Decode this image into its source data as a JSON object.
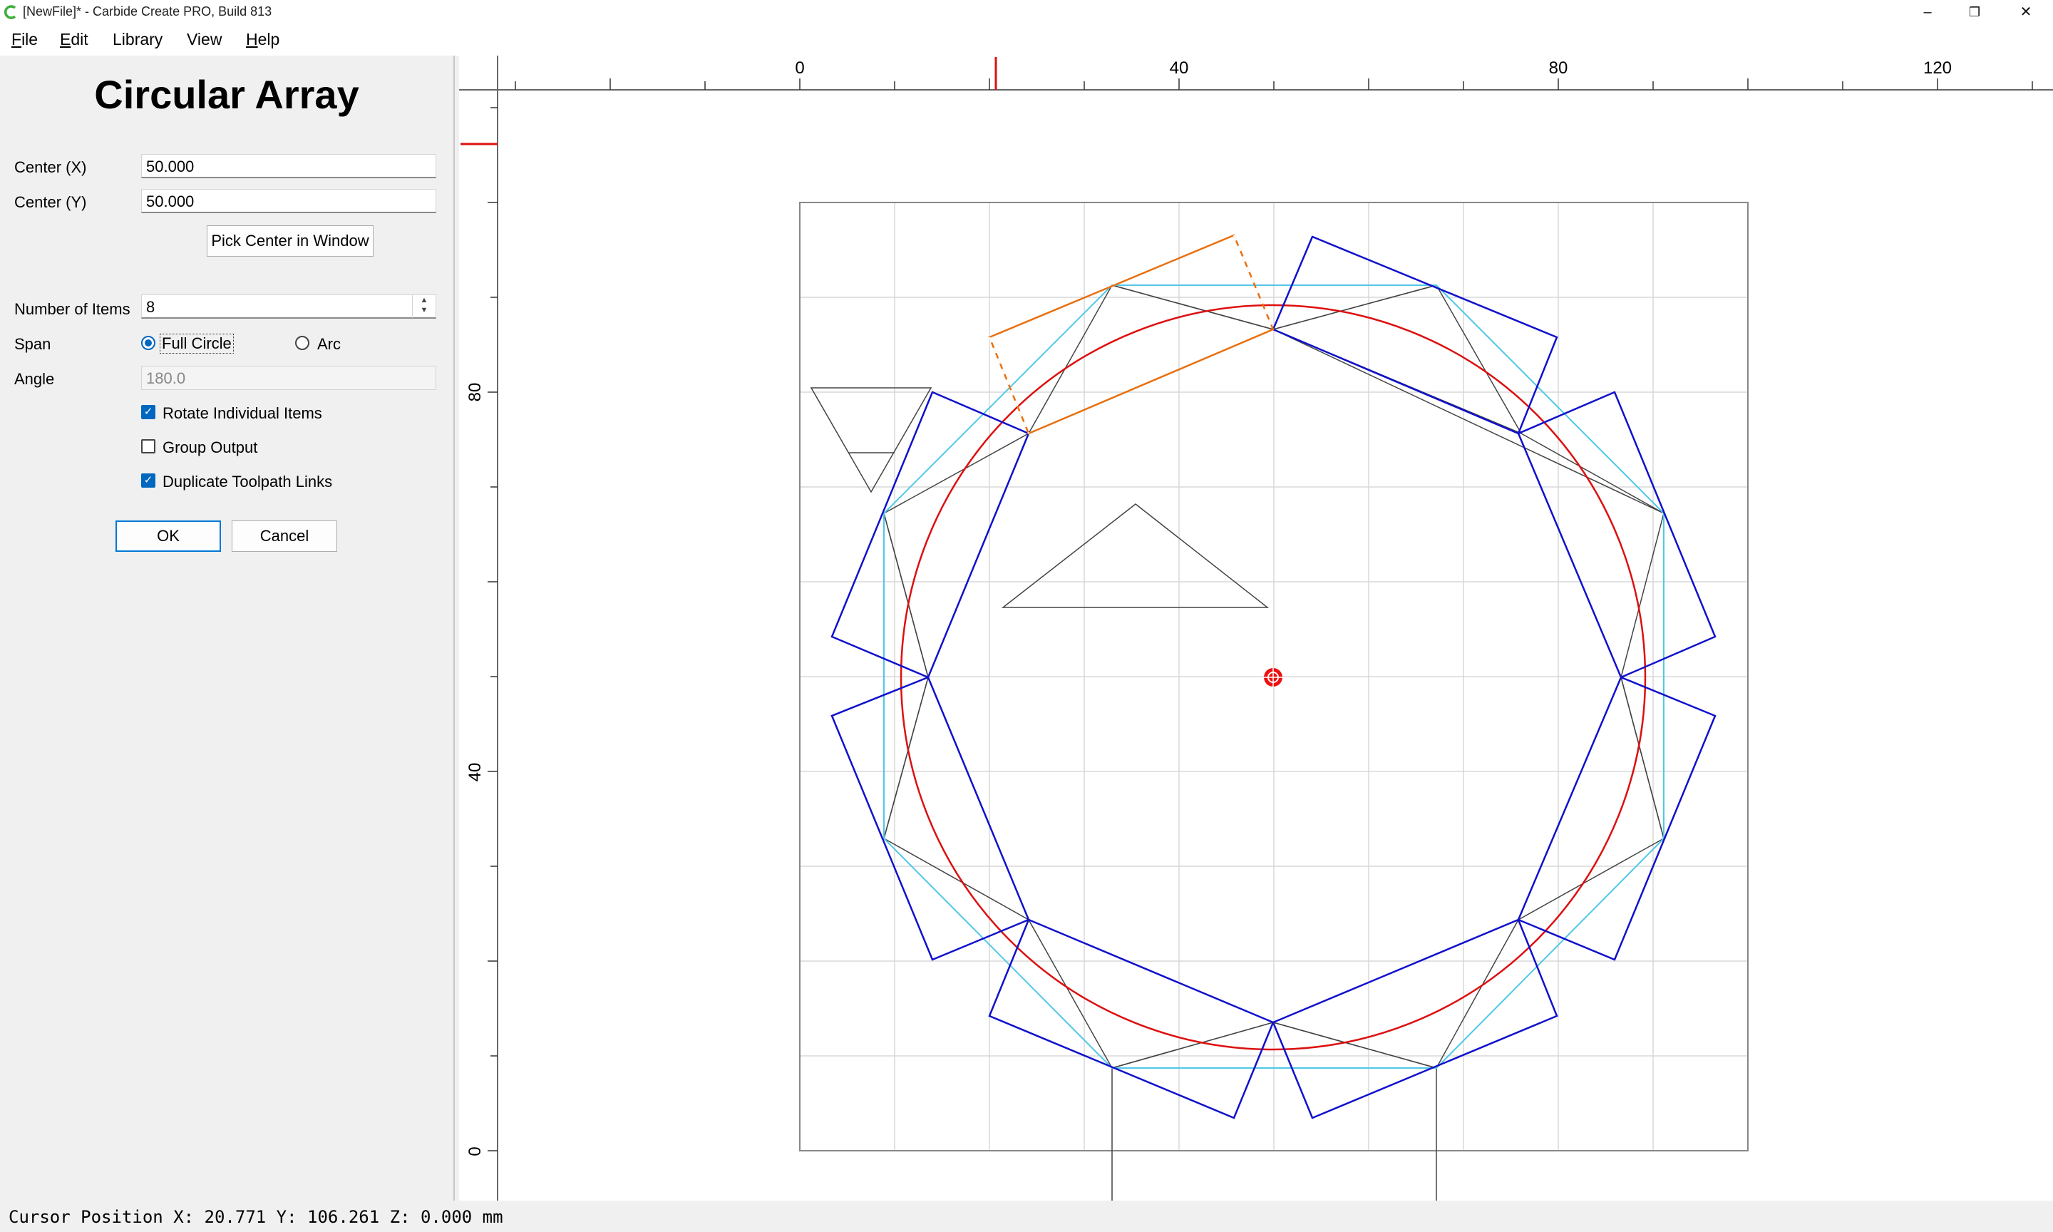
{
  "window": {
    "title": "[NewFile]* - Carbide Create PRO, Build 813",
    "minimize_glyph": "–",
    "maximize_glyph": "❐",
    "close_glyph": "✕",
    "icon": "carbide-c-logo",
    "accent": "#3cae3a"
  },
  "menu": [
    {
      "mnemonic": "F",
      "rest": "ile"
    },
    {
      "mnemonic": "E",
      "rest": "dit"
    },
    {
      "mnemonic": "",
      "rest": "Library"
    },
    {
      "mnemonic": "",
      "rest": "View"
    },
    {
      "mnemonic": "H",
      "rest": "elp"
    }
  ],
  "panel": {
    "title": "Circular Array",
    "center_x_label": "Center (X)",
    "center_x_value": "50.000",
    "center_y_label": "Center (Y)",
    "center_y_value": "50.000",
    "pick_center_label": "Pick Center in Window",
    "items_label": "Number of Items",
    "items_value": "8",
    "span_label": "Span",
    "span_full": "Full Circle",
    "span_arc": "Arc",
    "angle_label": "Angle",
    "angle_value": "180.0",
    "rotate_label": "Rotate Individual Items",
    "group_label": "Group Output",
    "duplicate_label": "Duplicate Toolpath Links",
    "ok_label": "OK",
    "cancel_label": "Cancel"
  },
  "ruler": {
    "x_labels": [
      "0",
      "40",
      "80",
      "120"
    ],
    "y_labels": [
      "80",
      "40",
      "0"
    ]
  },
  "status": {
    "cursor": "Cursor Position X: 20.771 Y: 106.261 Z: 0.000 mm"
  },
  "colors": {
    "array_items": "#1010cc",
    "selection": "#e87010",
    "circle": "#dd1010",
    "guide": "#50c8e8",
    "cursor_marker": "#ee1010"
  }
}
